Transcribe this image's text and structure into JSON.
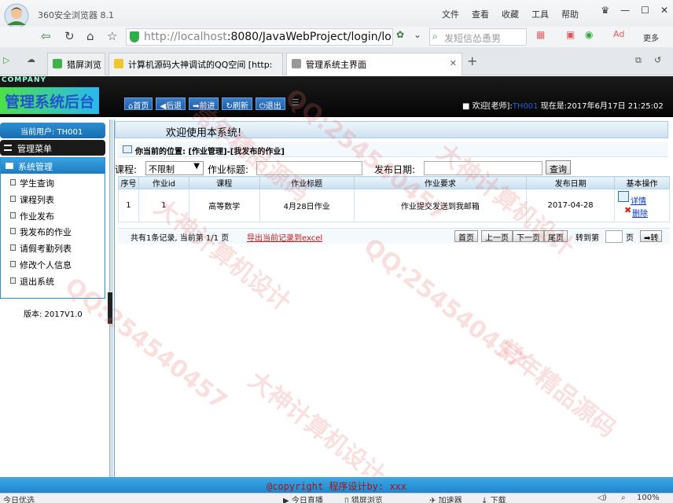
{
  "browser": {
    "name": "360安全浏览器 8.1",
    "menu": [
      "文件",
      "查看",
      "收藏",
      "工具",
      "帮助"
    ],
    "url_host": "http://localhost",
    "url_rest": ":8080/JavaWebProject/login/lo",
    "search_placeholder": "发短信怂恿男",
    "more_label": "更多",
    "tabs": [
      {
        "label": "猎屏浏览",
        "icon": "green-tab-icon"
      },
      {
        "label": "计算机源码大神调试的QQ空间 [http:",
        "icon": "star-tab-icon"
      },
      {
        "label": "管理系统主界面",
        "icon": "page-tab-icon",
        "active": true
      }
    ]
  },
  "app": {
    "company": "COMPANY",
    "title": "管理系统后台",
    "toolbar": [
      "首页",
      "后退",
      "前进",
      "刷新",
      "退出"
    ],
    "welcome": "欢迎[老师]:",
    "welcome_user": "TH001",
    "time_label": "现在是:",
    "time_value": "2017年6月17日 21:25:02"
  },
  "sidebar": {
    "current_user_label": "当前用户: TH001",
    "menu_title": "管理菜单",
    "group": "系统管理",
    "items": [
      "学生查询",
      "课程列表",
      "作业发布",
      "我发布的作业",
      "请假考勤列表",
      "修改个人信息",
      "退出系统"
    ],
    "version": "版本: 2017V1.0"
  },
  "main": {
    "welcome": "欢迎使用本系统!",
    "crumb": "你当前的位置: [作业管理]-[我发布的作业]",
    "search": {
      "course_label": "课程:",
      "course_value": "不限制",
      "title_label": "作业标题:",
      "date_label": "发布日期:",
      "query_button": "查询"
    },
    "table": {
      "headers": [
        "序号",
        "作业id",
        "课程",
        "作业标题",
        "作业要求",
        "发布日期",
        "基本操作"
      ],
      "rows": [
        {
          "index": "1",
          "id": "1",
          "course": "高等数学",
          "title": "4月28日作业",
          "requirement": "作业提交发送到我邮箱",
          "date": "2017-04-28",
          "detail": "详情",
          "delete": "删除"
        }
      ]
    },
    "pager": {
      "info": "共有1条记录, 当前第 1/1 页",
      "export": "导出当前记录到excel",
      "first": "首页",
      "prev": "上一页",
      "next": "下一页",
      "last": "尾页",
      "goto": "转到第",
      "unit": "页",
      "go": "➡转"
    }
  },
  "footer": {
    "copyright": "@copyright 程序设计by: xxx"
  },
  "statusbar": {
    "left": "今日优选",
    "live": "今日直播",
    "screen": "猎屏浏览",
    "accelerate": "加速器",
    "download": "下载",
    "zoom": "100%"
  },
  "watermark": [
    "QQ:254540457",
    "大神计算机设计",
    "常年精品源码"
  ]
}
